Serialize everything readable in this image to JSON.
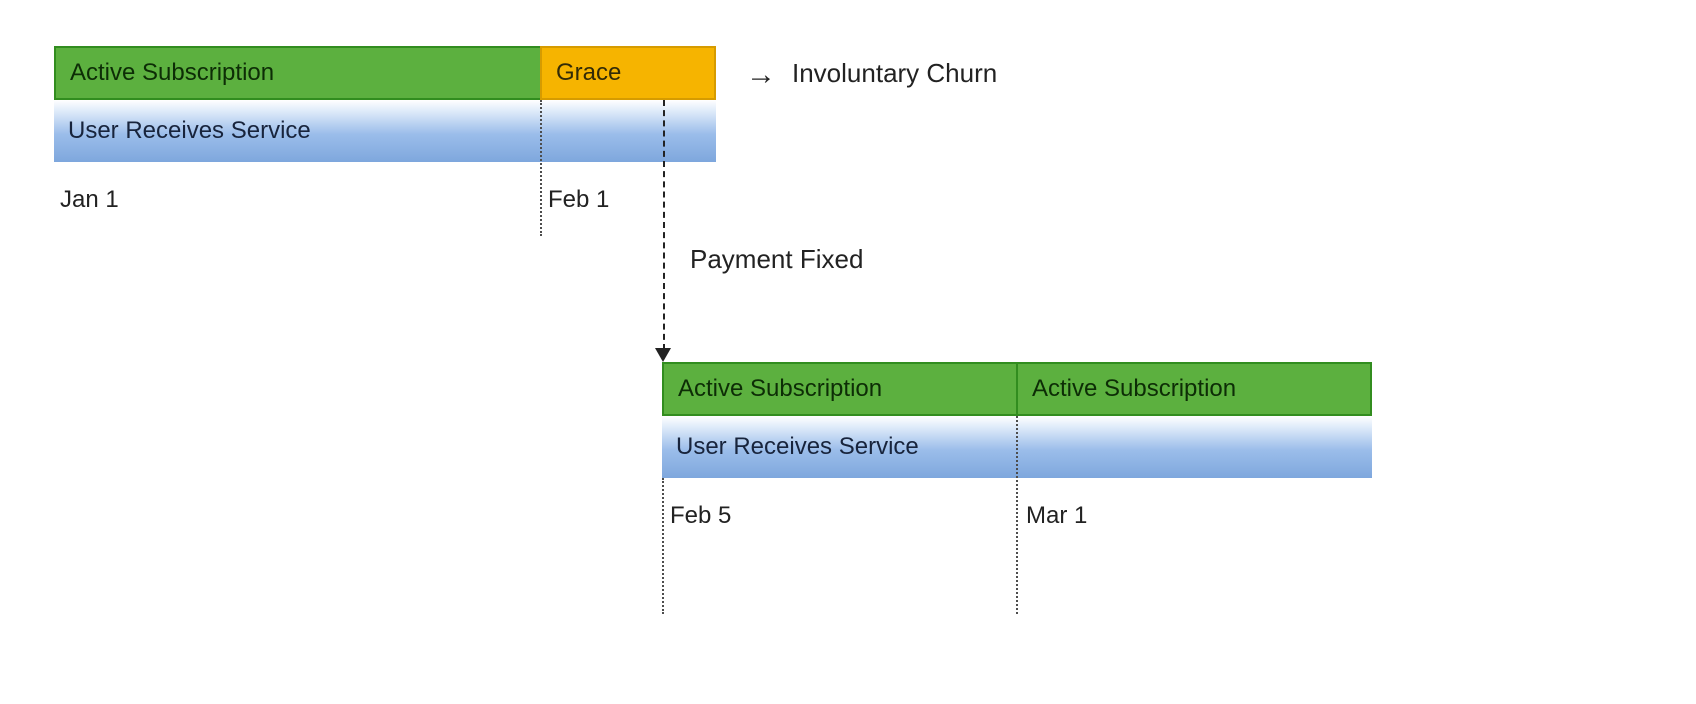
{
  "top": {
    "active_label": "Active Subscription",
    "grace_label": "Grace",
    "service_label": "User Receives Service",
    "date_start": "Jan 1",
    "date_grace": "Feb 1"
  },
  "annotation": {
    "arrow": "→",
    "churn_label": "Involuntary Churn",
    "payment_label": "Payment Fixed"
  },
  "bottom": {
    "active1_label": "Active Subscription",
    "active2_label": "Active Subscription",
    "service_label": "User Receives Service",
    "date_start": "Feb 5",
    "date_mid": "Mar 1"
  },
  "chart_data": {
    "type": "timeline",
    "title": "Subscription lifecycle with grace period and recovery",
    "timeline1": {
      "dates": [
        "Jan 1",
        "Feb 1"
      ],
      "segments": [
        {
          "label": "Active Subscription",
          "from": "Jan 1",
          "to": "Feb 1",
          "color": "#5cb03f"
        },
        {
          "label": "Grace",
          "from": "Feb 1",
          "to": "Feb 5",
          "color": "#f6b400"
        }
      ],
      "service_bar": {
        "label": "User Receives Service",
        "from": "Jan 1",
        "to": "Feb 5"
      },
      "outcome_if_no_fix": "Involuntary Churn"
    },
    "transition": {
      "event": "Payment Fixed",
      "at": "Feb 5",
      "arrow": "down"
    },
    "timeline2": {
      "dates": [
        "Feb 5",
        "Mar 1"
      ],
      "segments": [
        {
          "label": "Active Subscription",
          "from": "Feb 5",
          "to": "Mar 1",
          "color": "#5cb03f"
        },
        {
          "label": "Active Subscription",
          "from": "Mar 1",
          "to": "...",
          "color": "#5cb03f"
        }
      ],
      "service_bar": {
        "label": "User Receives Service",
        "from": "Feb 5",
        "to": "..."
      }
    }
  }
}
